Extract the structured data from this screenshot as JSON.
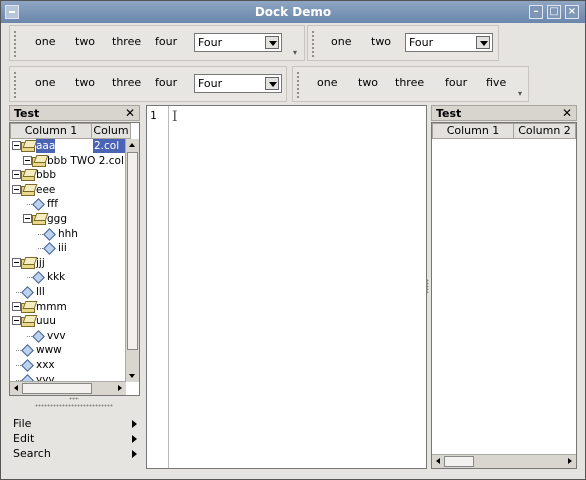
{
  "window": {
    "title": "Dock Demo"
  },
  "toolbars": {
    "row1_left": {
      "buttons": [
        "one",
        "two",
        "three",
        "four"
      ],
      "combo_value": "Four"
    },
    "row1_right": {
      "buttons": [
        "one",
        "two"
      ],
      "combo_value": "Four"
    },
    "row2_left": {
      "buttons": [
        "one",
        "two",
        "three",
        "four"
      ],
      "combo_value": "Four"
    },
    "row2_right": {
      "buttons": [
        "one",
        "two",
        "three",
        "four",
        "five"
      ]
    }
  },
  "left_dock": {
    "title": "Test",
    "columns": [
      "Column 1",
      "Colum"
    ],
    "tree": [
      {
        "name": "aaa",
        "col2": "2.col",
        "type": "folder",
        "expanded": true,
        "selected": true
      },
      {
        "name": "bbb TWO 2.col",
        "col2": "",
        "type": "folder",
        "expanded": true
      },
      {
        "name": "bbb",
        "col2": "",
        "type": "folder",
        "expanded": true
      },
      {
        "name": "eee",
        "col2": "",
        "type": "folder",
        "expanded": true
      },
      {
        "name": "fff",
        "col2": "",
        "type": "leaf"
      },
      {
        "name": "ggg",
        "col2": "",
        "type": "folder",
        "expanded": true
      },
      {
        "name": "hhh",
        "col2": "",
        "type": "leaf"
      },
      {
        "name": "iii",
        "col2": "",
        "type": "leaf"
      },
      {
        "name": "jjj",
        "col2": "",
        "type": "folder",
        "expanded": true
      },
      {
        "name": "kkk",
        "col2": "",
        "type": "leaf"
      },
      {
        "name": "lll",
        "col2": "",
        "type": "leaf"
      },
      {
        "name": "mmm",
        "col2": "",
        "type": "folder"
      },
      {
        "name": "uuu",
        "col2": "",
        "type": "folder",
        "expanded": true
      },
      {
        "name": "vvv",
        "col2": "",
        "type": "leaf"
      },
      {
        "name": "www",
        "col2": "",
        "type": "leaf"
      },
      {
        "name": "xxx",
        "col2": "",
        "type": "leaf"
      },
      {
        "name": "yyy",
        "col2": "",
        "type": "leaf"
      }
    ]
  },
  "menu": {
    "items": [
      "File",
      "Edit",
      "Search"
    ]
  },
  "editor": {
    "line_number": "1"
  },
  "right_dock": {
    "title": "Test",
    "columns": [
      "Column 1",
      "Column 2"
    ]
  },
  "icons": {
    "close": "close-icon",
    "folder": "folder-icon",
    "leaf": "diamond-icon"
  }
}
